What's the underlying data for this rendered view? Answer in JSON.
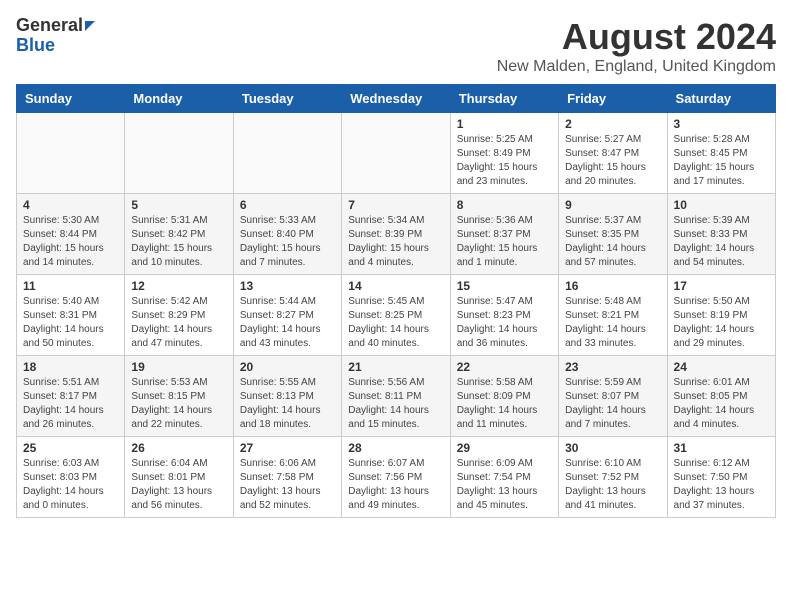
{
  "header": {
    "logo_general": "General",
    "logo_blue": "Blue",
    "main_title": "August 2024",
    "subtitle": "New Malden, England, United Kingdom"
  },
  "days_of_week": [
    "Sunday",
    "Monday",
    "Tuesday",
    "Wednesday",
    "Thursday",
    "Friday",
    "Saturday"
  ],
  "weeks": [
    [
      {
        "day": "",
        "info": ""
      },
      {
        "day": "",
        "info": ""
      },
      {
        "day": "",
        "info": ""
      },
      {
        "day": "",
        "info": ""
      },
      {
        "day": "1",
        "info": "Sunrise: 5:25 AM\nSunset: 8:49 PM\nDaylight: 15 hours\nand 23 minutes."
      },
      {
        "day": "2",
        "info": "Sunrise: 5:27 AM\nSunset: 8:47 PM\nDaylight: 15 hours\nand 20 minutes."
      },
      {
        "day": "3",
        "info": "Sunrise: 5:28 AM\nSunset: 8:45 PM\nDaylight: 15 hours\nand 17 minutes."
      }
    ],
    [
      {
        "day": "4",
        "info": "Sunrise: 5:30 AM\nSunset: 8:44 PM\nDaylight: 15 hours\nand 14 minutes."
      },
      {
        "day": "5",
        "info": "Sunrise: 5:31 AM\nSunset: 8:42 PM\nDaylight: 15 hours\nand 10 minutes."
      },
      {
        "day": "6",
        "info": "Sunrise: 5:33 AM\nSunset: 8:40 PM\nDaylight: 15 hours\nand 7 minutes."
      },
      {
        "day": "7",
        "info": "Sunrise: 5:34 AM\nSunset: 8:39 PM\nDaylight: 15 hours\nand 4 minutes."
      },
      {
        "day": "8",
        "info": "Sunrise: 5:36 AM\nSunset: 8:37 PM\nDaylight: 15 hours\nand 1 minute."
      },
      {
        "day": "9",
        "info": "Sunrise: 5:37 AM\nSunset: 8:35 PM\nDaylight: 14 hours\nand 57 minutes."
      },
      {
        "day": "10",
        "info": "Sunrise: 5:39 AM\nSunset: 8:33 PM\nDaylight: 14 hours\nand 54 minutes."
      }
    ],
    [
      {
        "day": "11",
        "info": "Sunrise: 5:40 AM\nSunset: 8:31 PM\nDaylight: 14 hours\nand 50 minutes."
      },
      {
        "day": "12",
        "info": "Sunrise: 5:42 AM\nSunset: 8:29 PM\nDaylight: 14 hours\nand 47 minutes."
      },
      {
        "day": "13",
        "info": "Sunrise: 5:44 AM\nSunset: 8:27 PM\nDaylight: 14 hours\nand 43 minutes."
      },
      {
        "day": "14",
        "info": "Sunrise: 5:45 AM\nSunset: 8:25 PM\nDaylight: 14 hours\nand 40 minutes."
      },
      {
        "day": "15",
        "info": "Sunrise: 5:47 AM\nSunset: 8:23 PM\nDaylight: 14 hours\nand 36 minutes."
      },
      {
        "day": "16",
        "info": "Sunrise: 5:48 AM\nSunset: 8:21 PM\nDaylight: 14 hours\nand 33 minutes."
      },
      {
        "day": "17",
        "info": "Sunrise: 5:50 AM\nSunset: 8:19 PM\nDaylight: 14 hours\nand 29 minutes."
      }
    ],
    [
      {
        "day": "18",
        "info": "Sunrise: 5:51 AM\nSunset: 8:17 PM\nDaylight: 14 hours\nand 26 minutes."
      },
      {
        "day": "19",
        "info": "Sunrise: 5:53 AM\nSunset: 8:15 PM\nDaylight: 14 hours\nand 22 minutes."
      },
      {
        "day": "20",
        "info": "Sunrise: 5:55 AM\nSunset: 8:13 PM\nDaylight: 14 hours\nand 18 minutes."
      },
      {
        "day": "21",
        "info": "Sunrise: 5:56 AM\nSunset: 8:11 PM\nDaylight: 14 hours\nand 15 minutes."
      },
      {
        "day": "22",
        "info": "Sunrise: 5:58 AM\nSunset: 8:09 PM\nDaylight: 14 hours\nand 11 minutes."
      },
      {
        "day": "23",
        "info": "Sunrise: 5:59 AM\nSunset: 8:07 PM\nDaylight: 14 hours\nand 7 minutes."
      },
      {
        "day": "24",
        "info": "Sunrise: 6:01 AM\nSunset: 8:05 PM\nDaylight: 14 hours\nand 4 minutes."
      }
    ],
    [
      {
        "day": "25",
        "info": "Sunrise: 6:03 AM\nSunset: 8:03 PM\nDaylight: 14 hours\nand 0 minutes."
      },
      {
        "day": "26",
        "info": "Sunrise: 6:04 AM\nSunset: 8:01 PM\nDaylight: 13 hours\nand 56 minutes."
      },
      {
        "day": "27",
        "info": "Sunrise: 6:06 AM\nSunset: 7:58 PM\nDaylight: 13 hours\nand 52 minutes."
      },
      {
        "day": "28",
        "info": "Sunrise: 6:07 AM\nSunset: 7:56 PM\nDaylight: 13 hours\nand 49 minutes."
      },
      {
        "day": "29",
        "info": "Sunrise: 6:09 AM\nSunset: 7:54 PM\nDaylight: 13 hours\nand 45 minutes."
      },
      {
        "day": "30",
        "info": "Sunrise: 6:10 AM\nSunset: 7:52 PM\nDaylight: 13 hours\nand 41 minutes."
      },
      {
        "day": "31",
        "info": "Sunrise: 6:12 AM\nSunset: 7:50 PM\nDaylight: 13 hours\nand 37 minutes."
      }
    ]
  ]
}
